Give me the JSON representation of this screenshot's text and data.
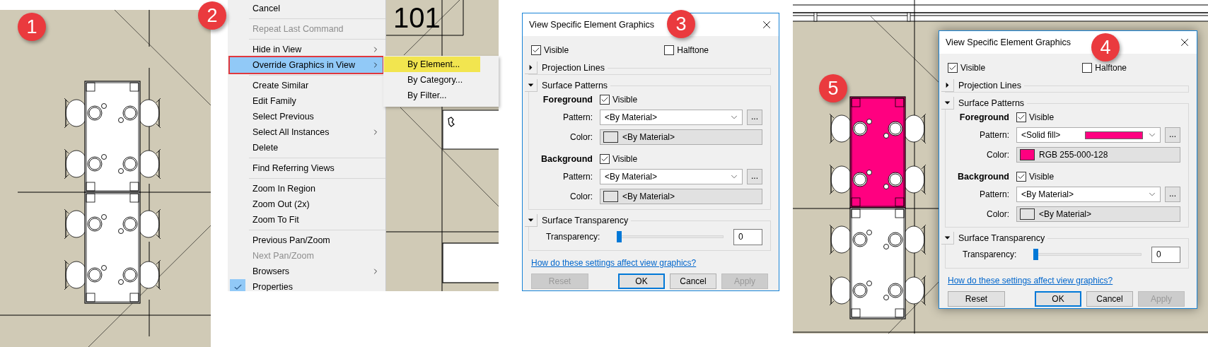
{
  "panels": [
    {
      "kind": "plan",
      "badge": "1"
    },
    {
      "kind": "menu",
      "badge": "2",
      "room_number": "101",
      "groups": [
        {
          "items": [
            {
              "label": "Cancel",
              "selected": false,
              "disabled": false,
              "checked": false,
              "has_submenu": false
            }
          ]
        },
        {
          "items": [
            {
              "label": "Repeat Last Command",
              "selected": false,
              "disabled": true,
              "checked": false,
              "has_submenu": false
            }
          ]
        },
        {
          "items": [
            {
              "label": "Hide in View",
              "selected": false,
              "disabled": false,
              "checked": false,
              "has_submenu": true
            },
            {
              "label": "Override Graphics in View",
              "selected": true,
              "disabled": false,
              "checked": false,
              "has_submenu": true
            }
          ]
        },
        {
          "items": [
            {
              "label": "Create Similar",
              "selected": false,
              "disabled": false,
              "checked": false,
              "has_submenu": false
            },
            {
              "label": "Edit Family",
              "selected": false,
              "disabled": false,
              "checked": false,
              "has_submenu": false
            },
            {
              "label": "Select Previous",
              "selected": false,
              "disabled": false,
              "checked": false,
              "has_submenu": false
            },
            {
              "label": "Select All Instances",
              "selected": false,
              "disabled": false,
              "checked": false,
              "has_submenu": true
            },
            {
              "label": "Delete",
              "selected": false,
              "disabled": false,
              "checked": false,
              "has_submenu": false
            }
          ]
        },
        {
          "items": [
            {
              "label": "Find Referring Views",
              "selected": false,
              "disabled": false,
              "checked": false,
              "has_submenu": false
            }
          ]
        },
        {
          "items": [
            {
              "label": "Zoom In Region",
              "selected": false,
              "disabled": false,
              "checked": false,
              "has_submenu": false
            },
            {
              "label": "Zoom Out (2x)",
              "selected": false,
              "disabled": false,
              "checked": false,
              "has_submenu": false
            },
            {
              "label": "Zoom To Fit",
              "selected": false,
              "disabled": false,
              "checked": false,
              "has_submenu": false
            }
          ]
        },
        {
          "items": [
            {
              "label": "Previous Pan/Zoom",
              "selected": false,
              "disabled": false,
              "checked": false,
              "has_submenu": false
            },
            {
              "label": "Next Pan/Zoom",
              "selected": false,
              "disabled": true,
              "checked": false,
              "has_submenu": false
            },
            {
              "label": "Browsers",
              "selected": false,
              "disabled": false,
              "checked": false,
              "has_submenu": true
            },
            {
              "label": "Properties",
              "selected": false,
              "disabled": false,
              "checked": true,
              "has_submenu": false
            }
          ]
        }
      ],
      "submenu": [
        {
          "label": "By Element...",
          "selected": true
        },
        {
          "label": "By Category...",
          "selected": false
        },
        {
          "label": "By Filter...",
          "selected": false
        }
      ]
    },
    {
      "kind": "dialog",
      "badge": "3",
      "dialog": {
        "title": "View Specific Element Graphics",
        "visible": {
          "label": "Visible",
          "checked": true
        },
        "halftone": {
          "label": "Halftone",
          "checked": false
        },
        "projection_lines": {
          "title": "Projection Lines",
          "expanded": false
        },
        "surface_patterns": {
          "title": "Surface Patterns",
          "expanded": true,
          "layers": [
            {
              "name": "Foreground",
              "visible_label": "Visible",
              "visible": true,
              "pattern_label": "Pattern:",
              "pattern": "<By Material>",
              "solid_fill": false,
              "browse": "...",
              "color_label": "Color:",
              "color_value": "<By Material>",
              "color": "#e3e3e3"
            },
            {
              "name": "Background",
              "visible_label": "Visible",
              "visible": true,
              "pattern_label": "Pattern:",
              "pattern": "<By Material>",
              "solid_fill": false,
              "browse": "...",
              "color_label": "Color:",
              "color_value": "<By Material>",
              "color": "#e3e3e3"
            }
          ]
        },
        "surface_transparency": {
          "title": "Surface Transparency",
          "expanded": true,
          "label": "Transparency:",
          "level": 0,
          "value": "0"
        },
        "help_link": "How do these settings affect view graphics?",
        "buttons": [
          {
            "label": "Reset",
            "disabled": true,
            "default": false
          },
          {
            "label": "OK",
            "disabled": false,
            "default": true
          },
          {
            "label": "Cancel",
            "disabled": false,
            "default": false
          },
          {
            "label": "Apply",
            "disabled": true,
            "default": false
          }
        ]
      }
    },
    {
      "kind": "plan_with_dialog",
      "badge": "4",
      "plan_badge": "5",
      "highlighted_table": {
        "color": "#ff0080"
      },
      "dialog": {
        "title": "View Specific Element Graphics",
        "visible": {
          "label": "Visible",
          "checked": true
        },
        "halftone": {
          "label": "Halftone",
          "checked": false
        },
        "projection_lines": {
          "title": "Projection Lines",
          "expanded": false
        },
        "surface_patterns": {
          "title": "Surface Patterns",
          "expanded": true,
          "layers": [
            {
              "name": "Foreground",
              "visible_label": "Visible",
              "visible": true,
              "pattern_label": "Pattern:",
              "pattern": "<Solid fill>",
              "solid_fill": true,
              "browse": "...",
              "color_label": "Color:",
              "color_value": "RGB 255-000-128",
              "color": "#ff0080"
            },
            {
              "name": "Background",
              "visible_label": "Visible",
              "visible": true,
              "pattern_label": "Pattern:",
              "pattern": "<By Material>",
              "solid_fill": false,
              "browse": "...",
              "color_label": "Color:",
              "color_value": "<By Material>",
              "color": "#e3e3e3"
            }
          ]
        },
        "surface_transparency": {
          "title": "Surface Transparency",
          "expanded": true,
          "label": "Transparency:",
          "level": 0,
          "value": "0"
        },
        "help_link": "How do these settings affect view graphics?",
        "buttons": [
          {
            "label": "Reset",
            "disabled": false,
            "default": false
          },
          {
            "label": "OK",
            "disabled": false,
            "default": true
          },
          {
            "label": "Cancel",
            "disabled": false,
            "default": false
          },
          {
            "label": "Apply",
            "disabled": true,
            "default": false
          }
        ]
      }
    }
  ]
}
